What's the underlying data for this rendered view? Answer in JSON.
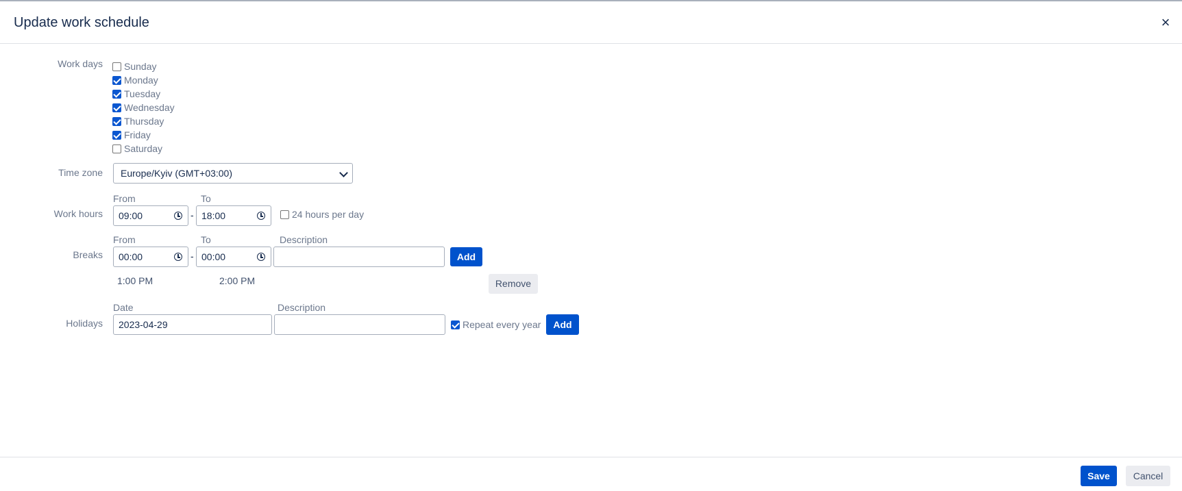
{
  "dialog": {
    "title": "Update work schedule",
    "close_glyph": "×"
  },
  "labels": {
    "work_days": "Work days",
    "time_zone": "Time zone",
    "work_hours": "Work hours",
    "breaks": "Breaks",
    "holidays": "Holidays"
  },
  "work_days": [
    {
      "label": "Sunday",
      "checked": false
    },
    {
      "label": "Monday",
      "checked": true
    },
    {
      "label": "Tuesday",
      "checked": true
    },
    {
      "label": "Wednesday",
      "checked": true
    },
    {
      "label": "Thursday",
      "checked": true
    },
    {
      "label": "Friday",
      "checked": true
    },
    {
      "label": "Saturday",
      "checked": false
    }
  ],
  "time_zone": {
    "value": "Europe/Kyiv (GMT+03:00)"
  },
  "work_hours": {
    "from_label": "From",
    "to_label": "To",
    "from": "09:00",
    "separator": "-",
    "to": "18:00",
    "all_day_label": "24 hours per day",
    "all_day_checked": false
  },
  "breaks": {
    "from_label": "From",
    "to_label": "To",
    "description_label": "Description",
    "from": "00:00",
    "separator": "-",
    "to": "00:00",
    "description": "",
    "add_label": "Add",
    "existing": [
      {
        "from": "1:00 PM",
        "to": "2:00 PM",
        "remove_label": "Remove"
      }
    ]
  },
  "holidays": {
    "date_label": "Date",
    "description_label": "Description",
    "date": "2023-04-29",
    "description": "",
    "repeat_label": "Repeat every year",
    "repeat_checked": true,
    "add_label": "Add"
  },
  "footer": {
    "save_label": "Save",
    "cancel_label": "Cancel"
  },
  "colors": {
    "primary": "#0052cc",
    "checkbox": "#0b57d0",
    "secondary_bg": "#ebecf0"
  },
  "icons": {
    "close": "close-icon",
    "dropdown": "chevron-down-icon",
    "time": "clock-icon"
  }
}
